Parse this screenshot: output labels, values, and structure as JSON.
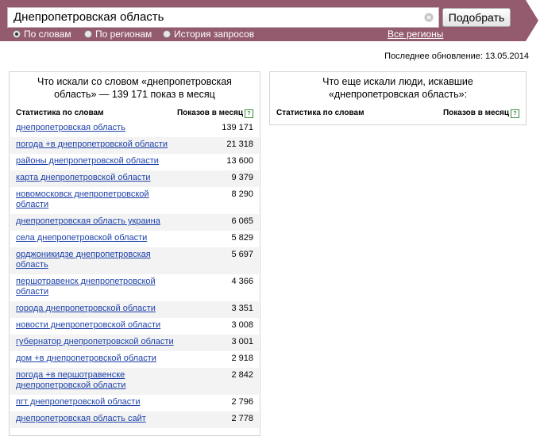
{
  "search": {
    "query": "Днепропетровская область",
    "button_label": "Подобрать",
    "modes": [
      {
        "label": "По словам",
        "selected": true
      },
      {
        "label": "По регионам",
        "selected": false
      },
      {
        "label": "История запросов",
        "selected": false
      }
    ],
    "all_regions": "Все регионы"
  },
  "last_update": "Последнее обновление: 13.05.2014",
  "left_panel": {
    "title": "Что искали со словом «днепропетровская область» — 139 171 показ в месяц",
    "col_words": "Статистика по словам",
    "col_shows": "Показов в месяц",
    "help": "?",
    "rows": [
      {
        "kw": "днепропетровская область",
        "count": "139 171"
      },
      {
        "kw": "погода +в днепропетровской области",
        "count": "21 318"
      },
      {
        "kw": "районы днепропетровской области",
        "count": "13 600"
      },
      {
        "kw": "карта днепропетровской области",
        "count": "9 379"
      },
      {
        "kw": "новомосковск днепропетровской области",
        "count": "8 290"
      },
      {
        "kw": "днепропетровская область украина",
        "count": "6 065"
      },
      {
        "kw": "села днепропетровской области",
        "count": "5 829"
      },
      {
        "kw": "орджоникидзе днепропетровская область",
        "count": "5 697"
      },
      {
        "kw": "першотравенск днепропетровской области",
        "count": "4 366"
      },
      {
        "kw": "города днепропетровской области",
        "count": "3 351"
      },
      {
        "kw": "новости днепропетровской области",
        "count": "3 008"
      },
      {
        "kw": "губернатор днепропетровской области",
        "count": "3 001"
      },
      {
        "kw": "дом +в днепропетровской области",
        "count": "2 918"
      },
      {
        "kw": "погода +в першотравенске днепропетровской области",
        "count": "2 842"
      },
      {
        "kw": "пгт днепропетровской области",
        "count": "2 796"
      },
      {
        "kw": "днепропетровская область сайт",
        "count": "2 778"
      }
    ]
  },
  "right_panel": {
    "title": "Что еще искали люди, искавшие «днепропетровская область»:",
    "col_words": "Статистика по словам",
    "col_shows": "Показов в месяц",
    "help": "?"
  },
  "colors": {
    "brand_band": "#945b6e",
    "link": "#1b3fa8",
    "help_icon": "#3a8a3a"
  },
  "icons": [
    "clear-icon",
    "help-icon",
    "radio-icon"
  ]
}
